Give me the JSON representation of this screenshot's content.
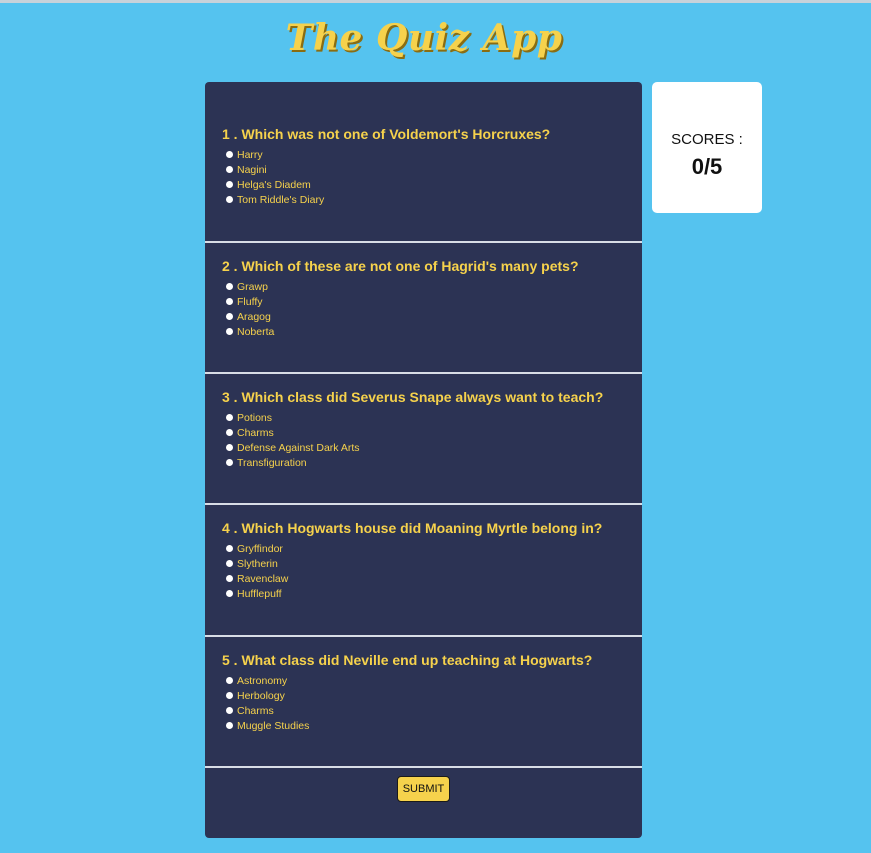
{
  "app": {
    "title": "The Quiz App"
  },
  "questions": [
    {
      "text": "1 . Which was not one of Voldemort's Horcruxes?",
      "options": [
        "Harry",
        "Nagini",
        "Helga's Diadem",
        "Tom Riddle's Diary"
      ]
    },
    {
      "text": "2 . Which of these are not one of Hagrid's many pets?",
      "options": [
        "Grawp",
        "Fluffy",
        "Aragog",
        "Noberta"
      ]
    },
    {
      "text": "3 . Which class did Severus Snape always want to teach?",
      "options": [
        "Potions",
        "Charms",
        "Defense Against Dark Arts",
        "Transfiguration"
      ]
    },
    {
      "text": "4 . Which Hogwarts house did Moaning Myrtle belong in?",
      "options": [
        "Gryffindor",
        "Slytherin",
        "Ravenclaw",
        "Hufflepuff"
      ]
    },
    {
      "text": "5 . What class did Neville end up teaching at Hogwarts?",
      "options": [
        "Astronomy",
        "Herbology",
        "Charms",
        "Muggle Studies"
      ]
    }
  ],
  "submit": {
    "label": "SUBMIT"
  },
  "score": {
    "label": "SCORES :",
    "value": "0/5"
  },
  "colors": {
    "background": "#55c3ef",
    "panel": "#2c3354",
    "accent": "#f6d24c",
    "card": "#ffffff"
  }
}
